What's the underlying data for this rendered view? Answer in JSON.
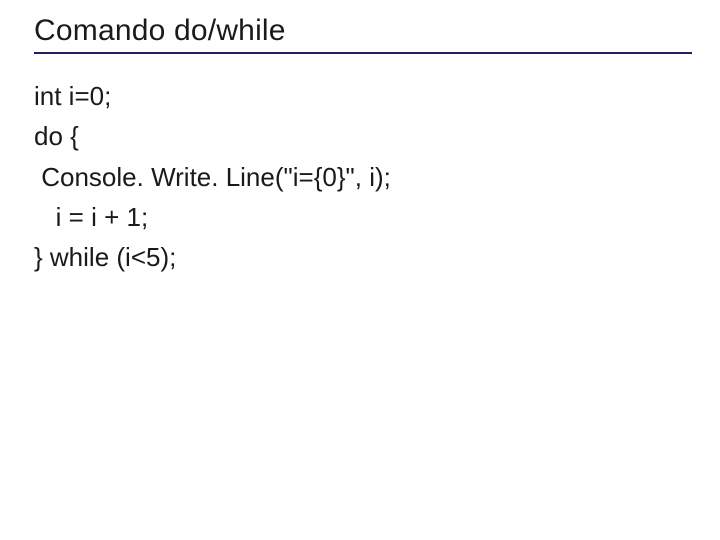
{
  "title": "Comando do/while",
  "code": {
    "line1": "int i=0;",
    "line2": "do {",
    "line3": " Console. Write. Line(\"i={0}\", i);",
    "line4": "   i = i + 1;",
    "line5": "} while (i<5);"
  }
}
